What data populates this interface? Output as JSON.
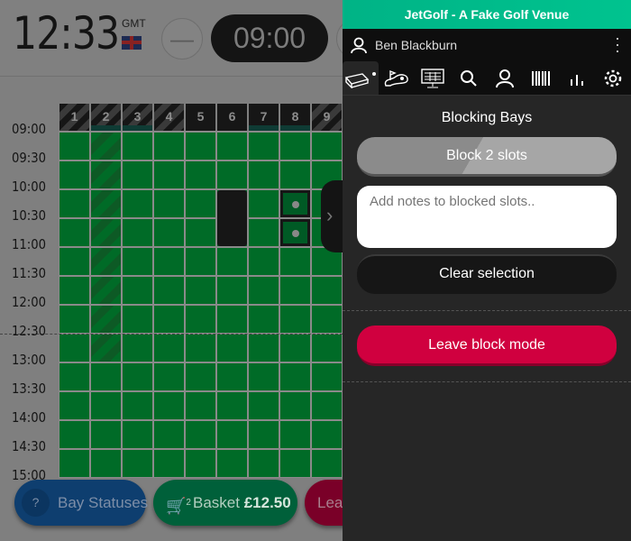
{
  "left": {
    "clock": "12:33",
    "timezone": "GMT",
    "flag_icon": "uk-flag",
    "time_pill": "09:00",
    "bays": [
      "1",
      "2",
      "3",
      "4",
      "5",
      "6",
      "7",
      "8",
      "9"
    ],
    "times": [
      "09:00",
      "09:30",
      "10:00",
      "10:30",
      "11:00",
      "11:30",
      "12:00",
      "12:30",
      "13:00",
      "13:30",
      "14:00",
      "14:30",
      "15:00"
    ],
    "bay_status_button": "Bay Statuses",
    "help_glyph": "?",
    "basket_label": "Basket",
    "basket_amount": "£12.50",
    "basket_count": "2",
    "leave_button": "Leave"
  },
  "colors": {
    "slot_available": "#0a8a34",
    "brand": "#00c38f",
    "leave": "#d0003f",
    "bay_statuses": "#1558a8"
  },
  "right": {
    "venue_title": "JetGolf - A Fake Golf Venue",
    "user_name": "Ben Blackburn",
    "panel_title": "Blocking Bays",
    "block_button": "Block 2 slots",
    "notes_placeholder": "Add notes to blocked slots..",
    "clear_button": "Clear selection",
    "leave_block_button": "Leave block mode"
  }
}
